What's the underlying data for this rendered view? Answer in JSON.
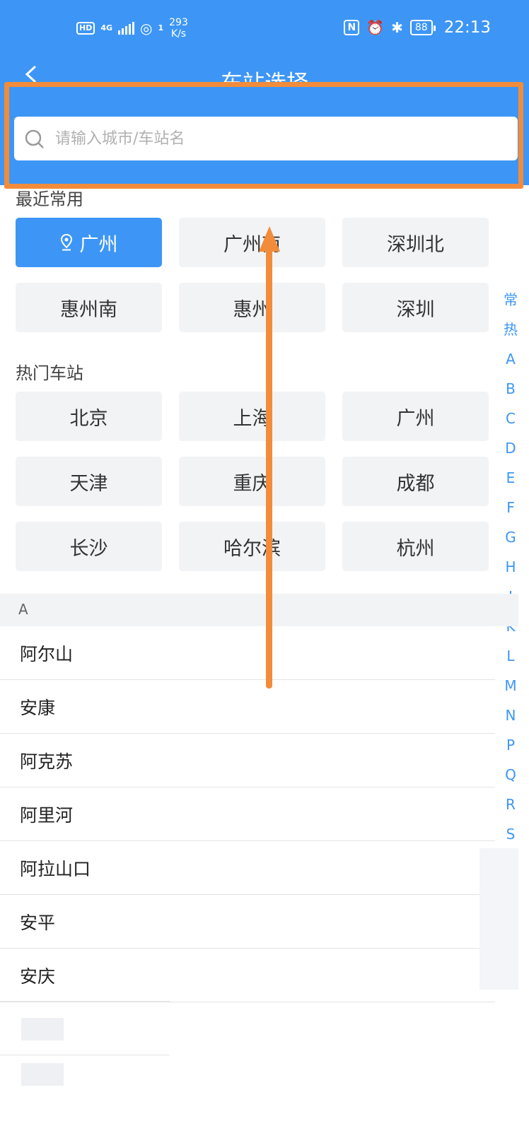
{
  "status_bar": {
    "hd": "HD",
    "signal": "4G",
    "wifi_sub": "1",
    "speed_value": "293",
    "speed_unit": "K/s",
    "nfc": "N",
    "battery": "88",
    "time": "22:13"
  },
  "header": {
    "title": "车站选择"
  },
  "search": {
    "placeholder": "请输入城市/车站名"
  },
  "recent": {
    "label": "最近常用",
    "items": [
      {
        "label": "广州",
        "active": true
      },
      {
        "label": "广州南",
        "active": false
      },
      {
        "label": "深圳北",
        "active": false
      },
      {
        "label": "惠州南",
        "active": false
      },
      {
        "label": "惠州",
        "active": false
      },
      {
        "label": "深圳",
        "active": false
      }
    ]
  },
  "hot": {
    "label": "热门车站",
    "items": [
      "北京",
      "上海",
      "广州",
      "天津",
      "重庆",
      "成都",
      "长沙",
      "哈尔滨",
      "杭州"
    ]
  },
  "index_bar": [
    "常",
    "热",
    "A",
    "B",
    "C",
    "D",
    "E",
    "F",
    "G",
    "H",
    "J",
    "K",
    "L",
    "M",
    "N",
    "P",
    "Q",
    "R",
    "S"
  ],
  "letter_section": {
    "letter": "A",
    "cities": [
      "阿尔山",
      "安康",
      "阿克苏",
      "阿里河",
      "阿拉山口",
      "安平",
      "安庆"
    ]
  },
  "colors": {
    "brand_blue": "#3d96f5",
    "annotation_orange": "#f28c3a"
  }
}
